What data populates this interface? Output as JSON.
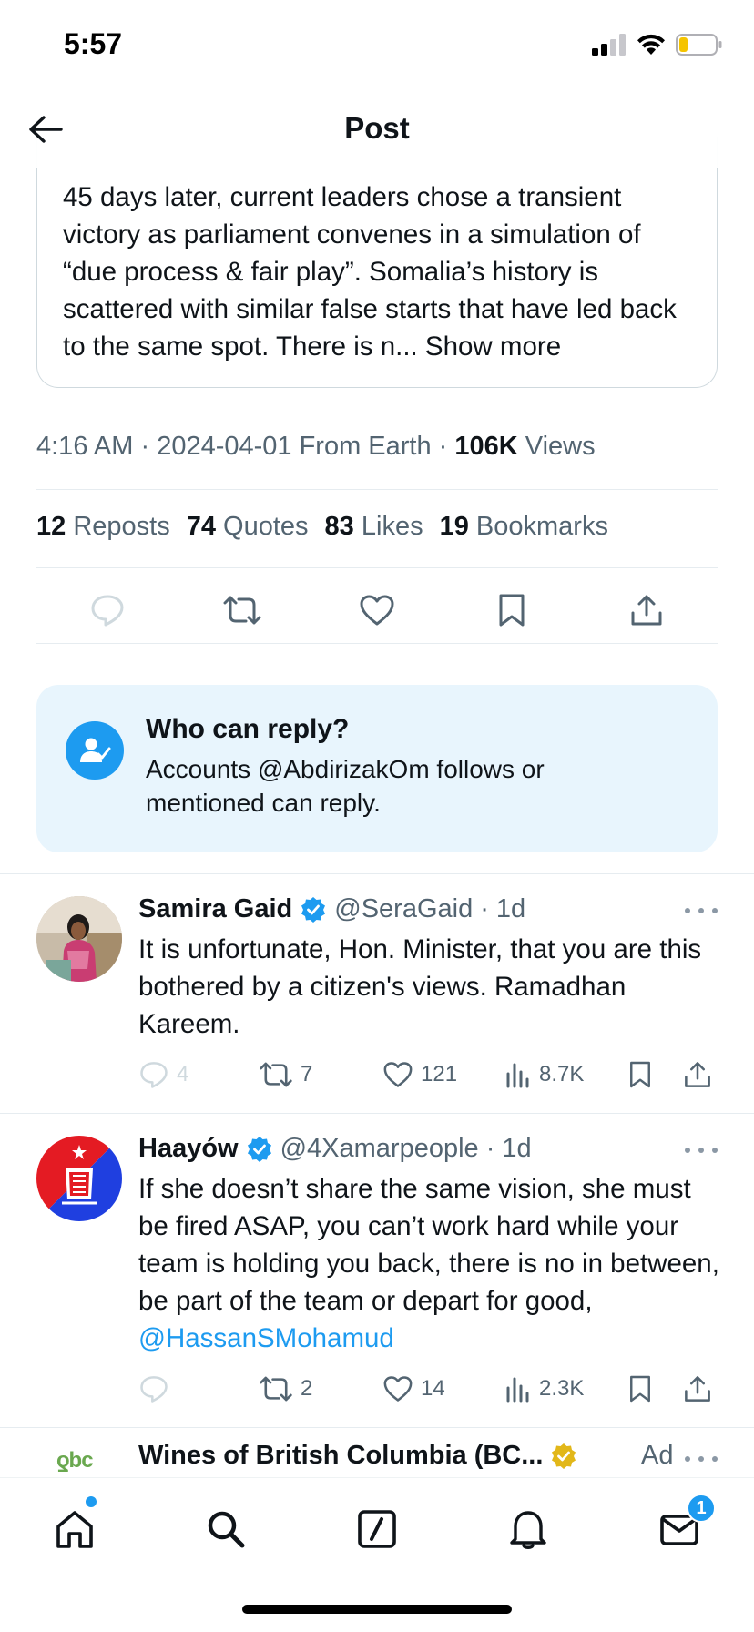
{
  "status_bar": {
    "time": "5:57"
  },
  "header": {
    "title": "Post"
  },
  "quoted_post": {
    "text": "45 days later, current leaders chose a transient victory as parliament convenes in a simulation of “due process & fair play”. Somalia’s history is scattered with similar false starts that have led back to the same spot. There is n...",
    "show_more": "Show more"
  },
  "meta": {
    "time": "4:16 AM",
    "date": "2024-04-01",
    "source": "From Earth",
    "views_count": "106K",
    "views_label": "Views"
  },
  "stats": [
    {
      "count": "12",
      "label": "Reposts"
    },
    {
      "count": "74",
      "label": "Quotes"
    },
    {
      "count": "83",
      "label": "Likes"
    },
    {
      "count": "19",
      "label": "Bookmarks"
    }
  ],
  "reply_settings": {
    "title": "Who can reply?",
    "description": "Accounts @AbdirizakOm follows or mentioned can reply."
  },
  "replies": [
    {
      "name": "Samira Gaid",
      "handle": "@SeraGaid",
      "time": "· 1d",
      "text": "It is unfortunate, Hon. Minister, that you are this bothered by a citizen's views. Ramadhan Kareem.",
      "comments": "4",
      "reposts": "7",
      "likes": "121",
      "views": "8.7K"
    },
    {
      "name": "Haayów",
      "handle": "@4Xamarpeople",
      "time": "· 1d",
      "text": "If she doesn’t share the same vision, she must be fired ASAP, you can’t work hard while your team is holding you back, there is no in between, be part of the team or depart for good,",
      "mention": "@HassanSMohamud",
      "comments": "",
      "reposts": "2",
      "likes": "14",
      "views": "2.3K"
    }
  ],
  "ad": {
    "name": "Wines of British Columbia (BC...",
    "label": "Ad",
    "logo_text": "ƍbc"
  },
  "nav": {
    "messages_badge": "1"
  },
  "colors": {
    "accent": "#1d9bf0",
    "muted": "#536471",
    "reply_box": "#e8f5fd"
  }
}
